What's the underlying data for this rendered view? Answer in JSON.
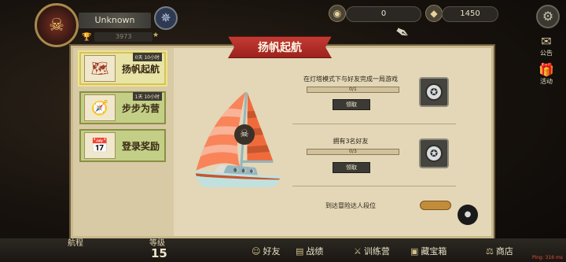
{
  "player": {
    "name": "Unknown",
    "score": "3973"
  },
  "resources": {
    "item1_value": "0",
    "item2_value": "1450"
  },
  "side_buttons": {
    "notice_label": "公告",
    "activity_label": "活动"
  },
  "panel": {
    "title": "扬帆起航",
    "tabs": [
      {
        "label": "扬帆起航",
        "timer": "0天 10小时",
        "active": true,
        "icon": "treasure-map-icon"
      },
      {
        "label": "步步为营",
        "timer": "1天 10小时",
        "active": false,
        "icon": "compass-icon"
      },
      {
        "label": "登录奖励",
        "timer": "",
        "active": false,
        "icon": "calendar-icon"
      }
    ],
    "tasks": [
      {
        "text": "在灯塔模式下与好友完成一局游戏",
        "progress": "0/1",
        "claim": "领取",
        "reward_icon": "mask-icon"
      },
      {
        "text": "拥有3名好友",
        "progress": "0/3",
        "claim": "领取",
        "reward_icon": "mask-icon"
      },
      {
        "text": "到达冒险达人段位",
        "progress": "",
        "claim": "",
        "reward_icon": "rank-token-icon"
      }
    ]
  },
  "bottom": {
    "journey_label": "航程",
    "level_label": "等级",
    "level_value": "15",
    "nav": [
      "好友",
      "战绩",
      "训练营",
      "藏宝箱",
      "商店"
    ],
    "ping": "Ping: 316 ms"
  },
  "colors": {
    "banner": "#c33b33",
    "tab_active": "#e8e4a7",
    "tab_inactive": "#c3cf86",
    "panel_bg": "#e3d7b7"
  }
}
